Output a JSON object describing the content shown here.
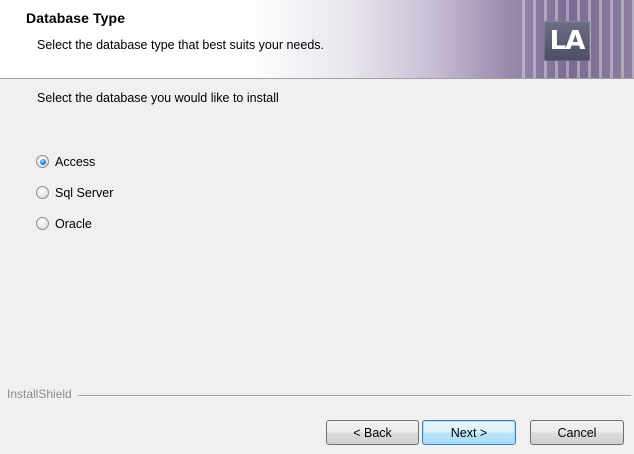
{
  "header": {
    "title": "Database Type",
    "subtitle": "Select the database type that best suits your needs.",
    "logo_text": "LA"
  },
  "content": {
    "instruction": "Select the database you would like to install",
    "options": [
      {
        "label": "Access",
        "checked": true
      },
      {
        "label": "Sql Server",
        "checked": false
      },
      {
        "label": "Oracle",
        "checked": false
      }
    ]
  },
  "footer": {
    "brand": "InstallShield",
    "buttons": {
      "back": "< Back",
      "next": "Next >",
      "cancel": "Cancel"
    }
  },
  "colors": {
    "background": "#f0f0f0",
    "banner_accent": "#7b6a92",
    "logo_bg": "#5a5a74",
    "radio_selected": "#2b7fd3"
  },
  "icons": {
    "logo": "la-logo-icon",
    "radio": "radio-button-icon"
  }
}
